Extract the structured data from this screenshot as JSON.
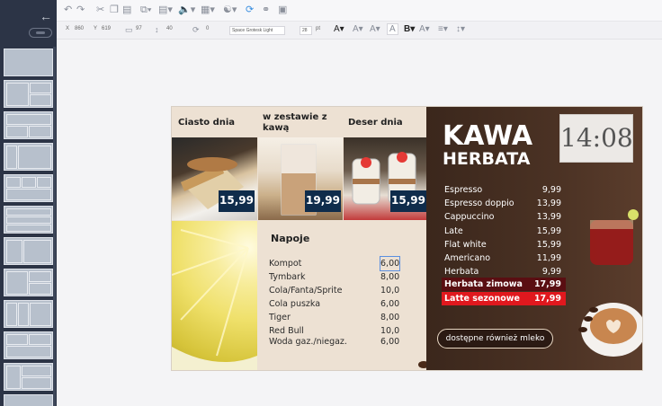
{
  "toolbar": {
    "x_label": "X",
    "x_value": "860",
    "y_label": "Y",
    "y_value": "619",
    "w_value": "97",
    "h_value": "40",
    "rot_value": "0",
    "font_name": "Space Grotesk Light",
    "font_size": "28",
    "font_unit": "pt"
  },
  "colors": {
    "sidebar_bg": "#2c3446",
    "accent": "#3b8fe0",
    "price_box": "#0f2c4b",
    "highlight_dark": "#5a0e12",
    "highlight_red": "#e0181e"
  },
  "menu": {
    "headers": [
      "Ciasto dnia",
      "w zestawie z kawą",
      "Deser dnia"
    ],
    "prices": [
      "15,99",
      "19,99",
      "15,99"
    ],
    "drinks_title": "Napoje",
    "drinks": [
      {
        "name": "Kompot",
        "price": "6,00"
      },
      {
        "name": "Tymbark",
        "price": "8,00"
      },
      {
        "name": "Cola/Fanta/Sprite",
        "price": "10,0"
      },
      {
        "name": "Cola puszka",
        "price": "6,00"
      },
      {
        "name": "Tiger",
        "price": "8,00"
      },
      {
        "name": "Red Bull",
        "price": "10,0"
      },
      {
        "name": "Woda gaz./niegaz.",
        "price": "6,00"
      }
    ],
    "title_main": "KAWA",
    "title_sub": "HERBATA",
    "clock": "14:08",
    "coffee": [
      {
        "name": "Espresso",
        "price": "9,99"
      },
      {
        "name": "Espresso doppio",
        "price": "13,99"
      },
      {
        "name": "Cappuccino",
        "price": "13,99"
      },
      {
        "name": "Late",
        "price": "15,99"
      },
      {
        "name": "Flat white",
        "price": "15,99"
      },
      {
        "name": "Americano",
        "price": "11,99"
      },
      {
        "name": "Herbata",
        "price": "9,99"
      },
      {
        "name": "Herbata zimowa",
        "price": "17,99"
      },
      {
        "name": "Latte sezonowe",
        "price": "17,99"
      }
    ],
    "footer_note": "dostępne również mleko"
  }
}
